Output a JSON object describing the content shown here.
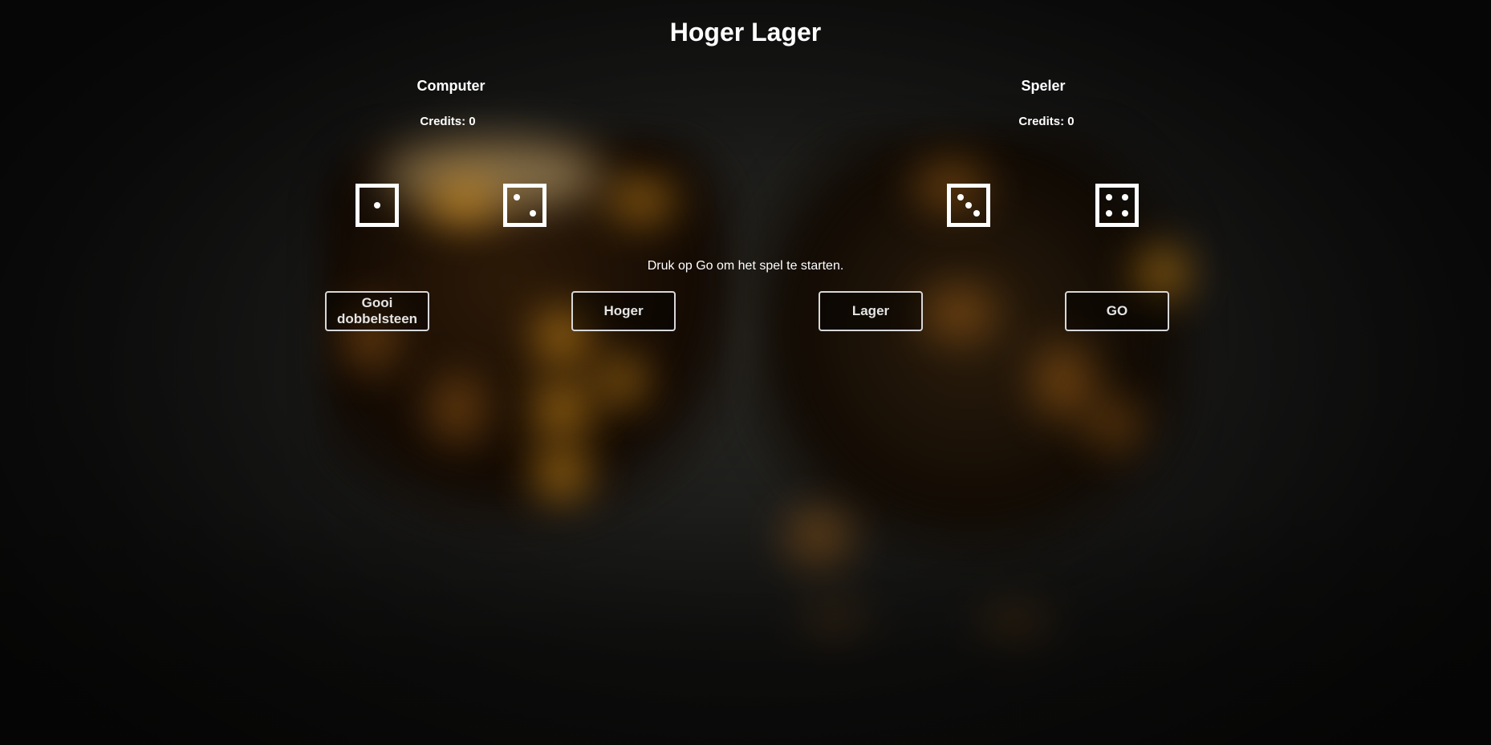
{
  "game": {
    "title": "Hoger Lager",
    "message": "Druk op Go om het spel te starten."
  },
  "computer": {
    "name": "Computer",
    "credits_label": "Credits: 0",
    "dice": [
      1,
      2
    ]
  },
  "player": {
    "name": "Speler",
    "credits_label": "Credits: 0",
    "dice": [
      3,
      4
    ]
  },
  "buttons": {
    "roll": "Gooi dobbelsteen",
    "higher": "Hoger",
    "lower": "Lager",
    "go": "GO"
  },
  "colors": {
    "text": "#ffffff",
    "button_border": "#d8d8d8",
    "button_text": "#e4e4e4",
    "background_glow": "#f4a21c"
  }
}
